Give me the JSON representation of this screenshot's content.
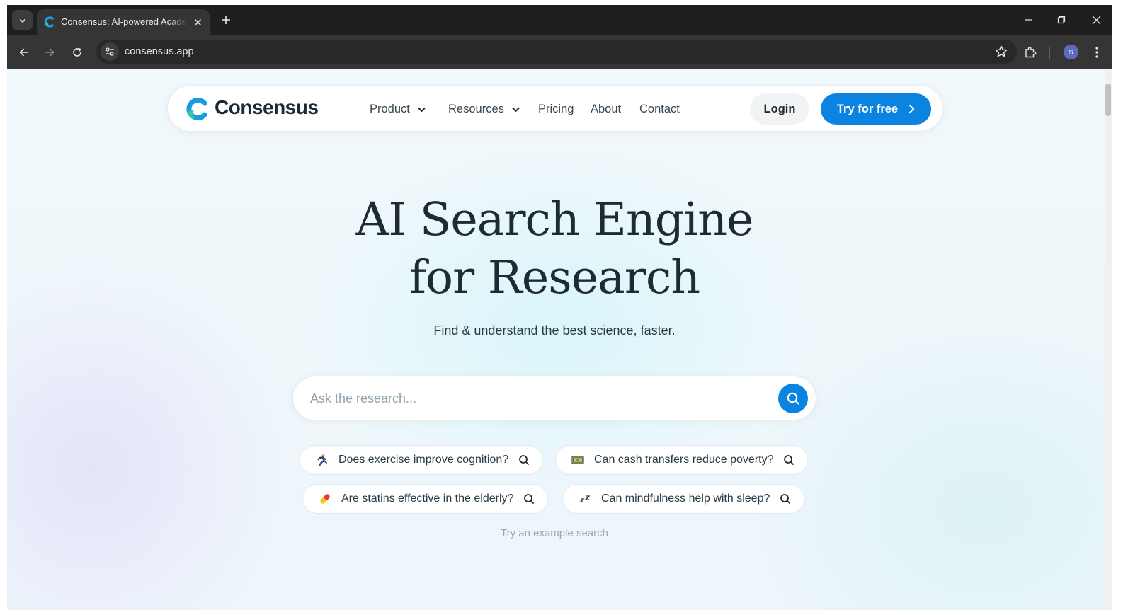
{
  "browser": {
    "tab": {
      "title": "Consensus: AI-powered Academic Search Engine"
    },
    "url": "consensus.app",
    "profile_initial": "S"
  },
  "site": {
    "brand": "Consensus",
    "nav": {
      "product": "Product",
      "resources": "Resources",
      "pricing": "Pricing",
      "about": "About",
      "contact": "Contact"
    },
    "login_label": "Login",
    "cta_label": "Try for free"
  },
  "hero": {
    "title_line1": "AI Search Engine",
    "title_line2": "for Research",
    "subtitle": "Find & understand the best science, faster."
  },
  "search": {
    "placeholder": "Ask the research...",
    "value": ""
  },
  "examples": [
    {
      "emoji": "running-person-icon",
      "label": "Does exercise improve cognition?"
    },
    {
      "emoji": "banknote-icon",
      "label": "Can cash transfers reduce poverty?"
    },
    {
      "emoji": "pill-icon",
      "label": "Are statins effective in the elderly?"
    },
    {
      "emoji": "zzz-icon",
      "label": "Can mindfulness help with sleep?"
    }
  ],
  "example_hint": "Try an example search",
  "colors": {
    "accent": "#0a84e0",
    "brand_green": "#34c8a0",
    "brand_blue": "#1a9be0",
    "text_dark": "#1f2b33"
  }
}
